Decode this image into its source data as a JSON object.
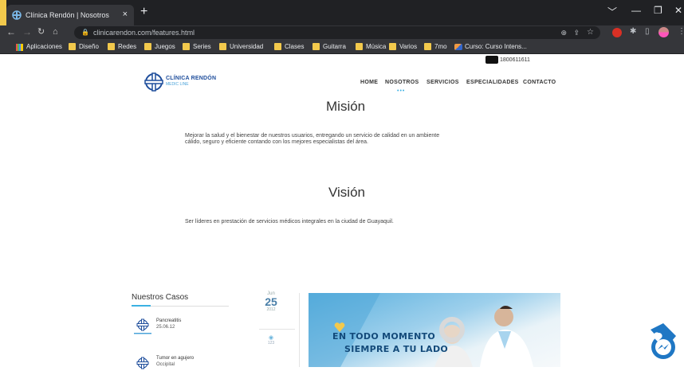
{
  "browser": {
    "tab_title": "Clínica Rendón | Nosotros",
    "tab_close": "×",
    "new_tab": "+",
    "url": "clinicarendon.com/features.html",
    "window_controls": [
      "﹀",
      "—",
      "❐",
      "✕"
    ]
  },
  "bookmarks": [
    {
      "label": "Aplicaciones",
      "icon": "apps-grid-icon"
    },
    {
      "label": "Diseño",
      "icon": "folder-icon"
    },
    {
      "label": "Redes",
      "icon": "folder-icon"
    },
    {
      "label": "Juegos",
      "icon": "folder-icon"
    },
    {
      "label": "Series",
      "icon": "folder-icon"
    },
    {
      "label": "Universidad",
      "icon": "folder-icon"
    },
    {
      "label": "Clases",
      "icon": "folder-icon"
    },
    {
      "label": "Guitarra",
      "icon": "folder-icon"
    },
    {
      "label": "Música",
      "icon": "folder-icon"
    },
    {
      "label": "Varios",
      "icon": "folder-icon"
    },
    {
      "label": "7mo",
      "icon": "folder-icon"
    },
    {
      "label": "Curso: Curso Intens...",
      "icon": "course-favicon"
    }
  ],
  "site": {
    "phone": "1800611611",
    "logo_name": "CLÍNICA RENDÓN",
    "logo_tagline": "MEDIC LINE",
    "menu": [
      "HOME",
      "NOSOTROS",
      "SERVICIOS",
      "ESPECIALIDADES",
      "CONTACTO"
    ],
    "active_menu": "NOSOTROS",
    "active_indicator": "•••"
  },
  "mision": {
    "title": "Misión",
    "text_line1": "Mejorar la salud y el bienestar de nuestros usuarios, entregando un servicio de calidad en un ambiente",
    "text_line2": "cálido, seguro y eficiente contando con los mejores especialistas del área."
  },
  "vision": {
    "title": "Visión",
    "text": "Ser líderes en prestación de servicios médicos integrales en la ciudad de Guayaquil."
  },
  "casos": {
    "title": "Nuestros Casos",
    "items": [
      {
        "name": "Pancreatitis",
        "date": "25.06.12"
      },
      {
        "name": "Tumor en agujero",
        "date": "Occipital"
      }
    ]
  },
  "post": {
    "month": "Jun",
    "day": "25",
    "year": "2012",
    "views": "123"
  },
  "banner": {
    "line1": "EN TODO MOMENTO",
    "line2": "SIEMPRE A TU LADO"
  },
  "colors": {
    "accent": "#3bb1e3",
    "brand": "#1f4e9c",
    "banner_text": "#134a7a"
  }
}
